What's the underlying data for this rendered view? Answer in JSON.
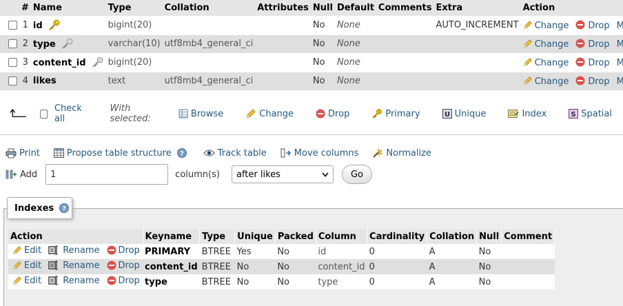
{
  "structure": {
    "headers": [
      "#",
      "Name",
      "Type",
      "Collation",
      "Attributes",
      "Null",
      "Default",
      "Comments",
      "Extra",
      "Action"
    ],
    "rows": [
      {
        "num": "1",
        "name": "id",
        "key": "primary",
        "type": "bigint(20)",
        "collation": "",
        "attributes": "",
        "null": "No",
        "default": "None",
        "comments": "",
        "extra": "AUTO_INCREMENT"
      },
      {
        "num": "2",
        "name": "type",
        "key": "index",
        "type": "varchar(10)",
        "collation": "utf8mb4_general_ci",
        "attributes": "",
        "null": "No",
        "default": "None",
        "comments": "",
        "extra": ""
      },
      {
        "num": "3",
        "name": "content_id",
        "key": "index",
        "type": "bigint(20)",
        "collation": "",
        "attributes": "",
        "null": "No",
        "default": "None",
        "comments": "",
        "extra": ""
      },
      {
        "num": "4",
        "name": "likes",
        "key": "",
        "type": "text",
        "collation": "utf8mb4_general_ci",
        "attributes": "",
        "null": "No",
        "default": "None",
        "comments": "",
        "extra": ""
      }
    ],
    "row_actions": {
      "change": "Change",
      "drop": "Drop",
      "more": "More"
    }
  },
  "bulk": {
    "check_all": "Check all",
    "with_selected": "With selected:",
    "browse": "Browse",
    "change": "Change",
    "drop": "Drop",
    "primary": "Primary",
    "unique": "Unique",
    "index": "Index",
    "spatial": "Spatial"
  },
  "tools": {
    "print": "Print",
    "propose": "Propose table structure",
    "track": "Track table",
    "move": "Move columns",
    "normalize": "Normalize"
  },
  "add_columns": {
    "label": "Add",
    "value": "1",
    "suffix": "column(s)",
    "position": "after likes",
    "go": "Go"
  },
  "indexes": {
    "legend": "Indexes",
    "headers": [
      "Action",
      "Keyname",
      "Type",
      "Unique",
      "Packed",
      "Column",
      "Cardinality",
      "Collation",
      "Null",
      "Comment"
    ],
    "actions": {
      "edit": "Edit",
      "rename": "Rename",
      "drop": "Drop"
    },
    "rows": [
      {
        "keyname": "PRIMARY",
        "type": "BTREE",
        "unique": "Yes",
        "packed": "No",
        "column": "id",
        "cardinality": "0",
        "collation": "A",
        "null": "No",
        "comment": ""
      },
      {
        "keyname": "content_id",
        "type": "BTREE",
        "unique": "No",
        "packed": "No",
        "column": "content_id",
        "cardinality": "0",
        "collation": "A",
        "null": "No",
        "comment": ""
      },
      {
        "keyname": "type",
        "type": "BTREE",
        "unique": "No",
        "packed": "No",
        "column": "type",
        "cardinality": "0",
        "collation": "A",
        "null": "No",
        "comment": ""
      }
    ]
  },
  "colors": {
    "link": "#235a81",
    "header_bg": "#e5e5e5",
    "row_alt": "#dfdfdf",
    "drop_red": "#d9534f",
    "key_gold": "#e0b400"
  }
}
